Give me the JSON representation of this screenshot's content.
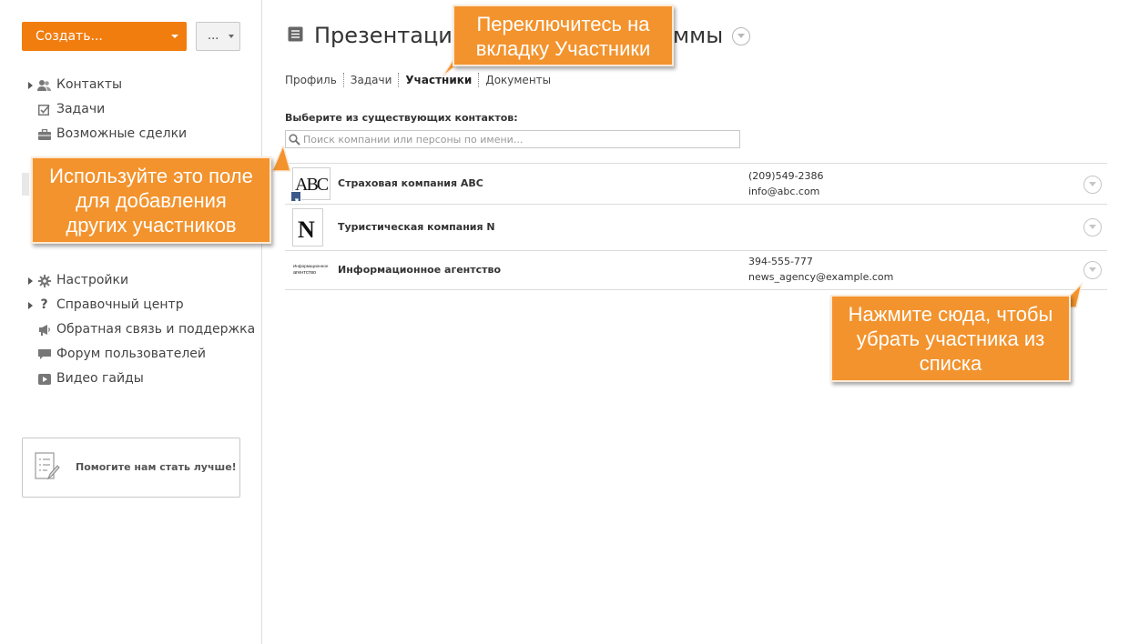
{
  "toolbar": {
    "create_label": "Создать...",
    "more_label": "..."
  },
  "sidebar": {
    "items": [
      {
        "label": "Контакты",
        "icon": "contacts-icon",
        "expandable": true
      },
      {
        "label": "Задачи",
        "icon": "tasks-checkbox-icon",
        "expandable": false
      },
      {
        "label": "Возможные сделки",
        "icon": "deals-briefcase-icon",
        "expandable": false
      }
    ],
    "bottom_items": [
      {
        "label": "Настройки",
        "icon": "gear-icon",
        "expandable": true
      },
      {
        "label": "Справочный центр",
        "icon": "question-icon",
        "expandable": true
      },
      {
        "label": "Обратная связь и поддержка",
        "icon": "megaphone-icon",
        "expandable": false
      },
      {
        "label": "Форум пользователей",
        "icon": "chat-bubble-icon",
        "expandable": false
      },
      {
        "label": "Видео гайды",
        "icon": "video-play-icon",
        "expandable": false
      }
    ],
    "feedback_label": "Помогите нам стать лучше!"
  },
  "main": {
    "title": "Презентация",
    "title_suffix": "ммы",
    "tabs": [
      {
        "label": "Профиль",
        "active": false
      },
      {
        "label": "Задачи",
        "active": false
      },
      {
        "label": "Участники",
        "active": true
      },
      {
        "label": "Документы",
        "active": false
      }
    ],
    "select_label": "Выберите из существующих контактов:",
    "search_placeholder": "Поиск компании или персоны по имени..."
  },
  "contacts": [
    {
      "name": "Страховая компания ABC",
      "phone": "(209)549-2386",
      "email": "info@abc.com",
      "logo_text": "ABC"
    },
    {
      "name": "Туристическая компания N",
      "phone": "",
      "email": "",
      "logo_text": "N"
    },
    {
      "name": "Информационное агентство",
      "phone": "394-555-777",
      "email": "news_agency@example.com",
      "logo_lines": [
        "Информационное",
        "агентство"
      ]
    }
  ],
  "callouts": {
    "tab_hint": [
      "Переключитесь на",
      "вкладку Участники"
    ],
    "field_hint": [
      "Используйте это поле",
      "для добавления",
      "других участников"
    ],
    "remove_hint": [
      "Нажмите сюда, чтобы",
      "убрать участника из",
      "списка"
    ]
  },
  "colors": {
    "accent": "#f27d0f",
    "callout": "#f3932d",
    "border": "#dcdcdc"
  }
}
